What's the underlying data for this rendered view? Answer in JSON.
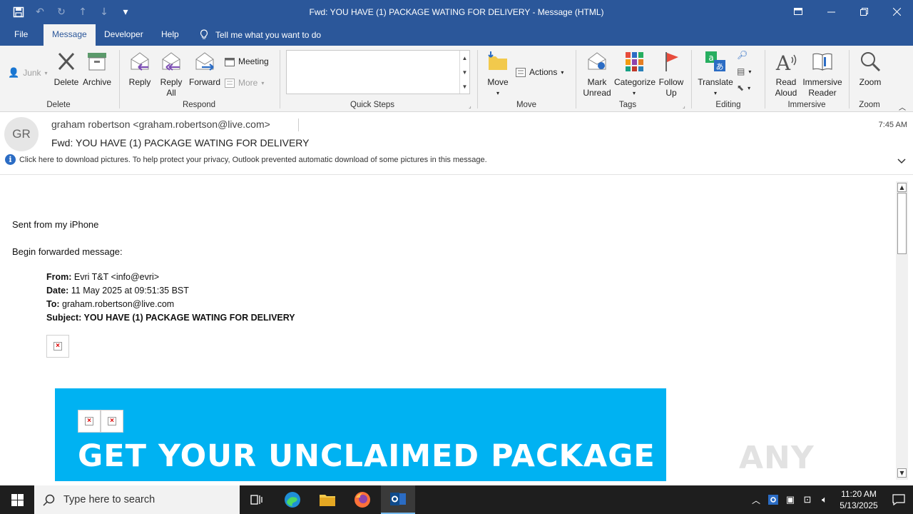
{
  "window": {
    "title": "Fwd: YOU HAVE (1) PACKAGE WATING FOR DELIVERY  -  Message (HTML)"
  },
  "tabs": {
    "file": "File",
    "message": "Message",
    "developer": "Developer",
    "help": "Help",
    "tell_me": "Tell me what you want to do"
  },
  "ribbon": {
    "junk": "Junk",
    "delete": "Delete",
    "archive": "Archive",
    "group_delete": "Delete",
    "reply": "Reply",
    "reply_all_1": "Reply",
    "reply_all_2": "All",
    "forward": "Forward",
    "meeting": "Meeting",
    "more": "More",
    "group_respond": "Respond",
    "group_quick_steps": "Quick Steps",
    "move": "Move",
    "actions": "Actions",
    "group_move": "Move",
    "mark_unread_1": "Mark",
    "mark_unread_2": "Unread",
    "categorize": "Categorize",
    "follow_up_1": "Follow",
    "follow_up_2": "Up",
    "group_tags": "Tags",
    "translate": "Translate",
    "group_editing": "Editing",
    "read_aloud_1": "Read",
    "read_aloud_2": "Aloud",
    "immersive_reader_1": "Immersive",
    "immersive_reader_2": "Reader",
    "group_immersive": "Immersive",
    "zoom": "Zoom",
    "group_zoom": "Zoom"
  },
  "message": {
    "avatar_initials": "GR",
    "sender": "graham robertson <graham.robertson@live.com>",
    "subject": "Fwd: YOU HAVE (1) PACKAGE WATING FOR DELIVERY",
    "time": "7:45 AM",
    "info_bar": "Click here to download pictures. To help protect your privacy, Outlook prevented automatic download of some pictures in this message."
  },
  "body": {
    "line1": "Sent from my iPhone",
    "line2": "Begin forwarded message:",
    "from_label": "From:",
    "from_value": " Evri T&T <info@evri>",
    "date_label": "Date:",
    "date_value": " 11 May 2025 at 09:51:35 BST",
    "to_label": "To:",
    "to_value": " graham.robertson@live.com",
    "subject_label": "Subject:",
    "subject_value": " YOU HAVE (1) PACKAGE WATING FOR DELIVERY",
    "banner_text": "GET YOUR UNCLAIMED PACKAGE",
    "banner_color": "#00b2f2",
    "watermark": "ANY RUN"
  },
  "taskbar": {
    "search_placeholder": "Type here to search",
    "time": "11:20 AM",
    "date": "5/13/2025"
  },
  "colors": {
    "accent": "#2b579a"
  }
}
